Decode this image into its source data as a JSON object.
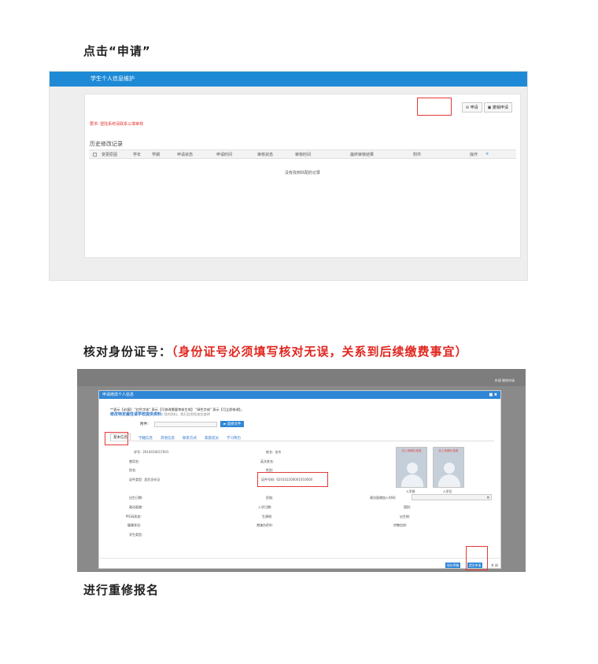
{
  "headings": {
    "step1": "点击“申请”",
    "step2_prefix": "核对身份证号：",
    "step2_highlight": "（身份证号必须填写核对无误，关系到后续缴费事宜）",
    "step3": "进行重修报名"
  },
  "shot1": {
    "window_title": "学生个人信息维护",
    "apply_button": "申请",
    "withdraw_button": "撤销申请",
    "tip": "要求: 登陆系统请联系以填审核",
    "section_title": "历史修改记录",
    "columns": [
      "变更原因",
      "学年",
      "学期",
      "申请状态",
      "申请时间",
      "审核状态",
      "审核时间",
      "最终审核结果",
      "附件",
      "操作"
    ],
    "empty_text": "没有找到匹配的记录"
  },
  "shot2": {
    "top_buttons": "申请   撤销申请",
    "dialog_title": "申请修改个人信息",
    "close_icon": "■ ✖",
    "notice_line1": "**表示【必填】 \"红色字体\" 表示【可修改需要审核生效】 \"绿色字体\" 表示【可立即修改】。",
    "notice_line2_bold": "修改特定属性请学校提供资料:",
    "notice_line2_gray": "您的资料，我们会帮您核实查明",
    "attach_label": "附件：",
    "select_file_button": "选择文件",
    "tabs": [
      "基本信息",
      "学籍信息",
      "其他信息",
      "联系方式",
      "家庭成员",
      "学习简历"
    ],
    "fields": {
      "student_id_label": "学号:",
      "student_id_value": "2014010017001",
      "name_label": "姓名:",
      "name_value": "张杰",
      "former_name_label": "曾用名:",
      "english_name_label": "英文姓名:",
      "alias_label": "别名:",
      "gender_label": "性别:",
      "id_type_label": "证件类型:",
      "id_type_value": "居民身份证",
      "id_number_label": "证件号码:",
      "id_number_value": "620102200001010000",
      "birth_date_label": "出生日期:",
      "ethnicity_label": "民族:",
      "party_join_date_label": "政治面貌加入时间:",
      "political_status_label": "政治面貌:",
      "enroll_date_label": "入学日期:",
      "nationality_label": "国别:",
      "pic_label": "PIC码状态:",
      "birthplace_label": "生源地:",
      "origin_label": "出生地:",
      "health_label": "健康状况:",
      "hukou_label": "港澳台侨外:",
      "religion_label": "宗教信仰:",
      "student_type_label": "学生类型:"
    },
    "photos": [
      {
        "label": "无上传照片信息",
        "caption": "入学前"
      },
      {
        "label": "无上传照片信息",
        "caption": "入学后"
      }
    ],
    "footer_buttons": {
      "save_draft": "保存草稿",
      "submit": "提交申请",
      "close": "关 闭"
    }
  }
}
